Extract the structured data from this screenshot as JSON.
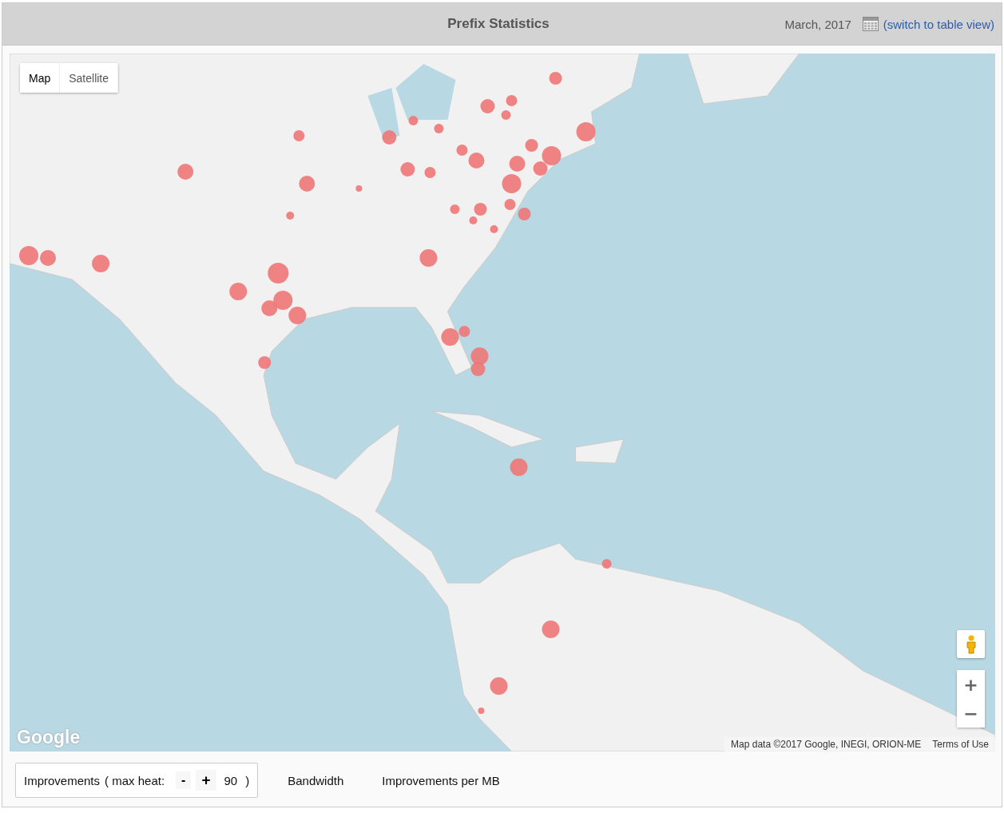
{
  "header": {
    "title": "Prefix Statistics",
    "period": "March, 2017",
    "view_link": "(switch to table view)"
  },
  "map": {
    "map_types": [
      {
        "label": "Map",
        "selected": true
      },
      {
        "label": "Satellite",
        "selected": false
      }
    ],
    "logo": "Google",
    "attribution": "Map data ©2017 Google, INEGI, ORION-ME",
    "terms": "Terms of Use",
    "zoom_in": "+",
    "zoom_out": "−"
  },
  "metrics": [
    {
      "label": "Improvements",
      "selected": true,
      "max_heat": {
        "label": "( max heat:",
        "decrease": "-",
        "increase": "+",
        "value": "90",
        "close": ")"
      }
    },
    {
      "label": "Bandwidth",
      "selected": false
    },
    {
      "label": "Improvements per MB",
      "selected": false
    }
  ]
}
